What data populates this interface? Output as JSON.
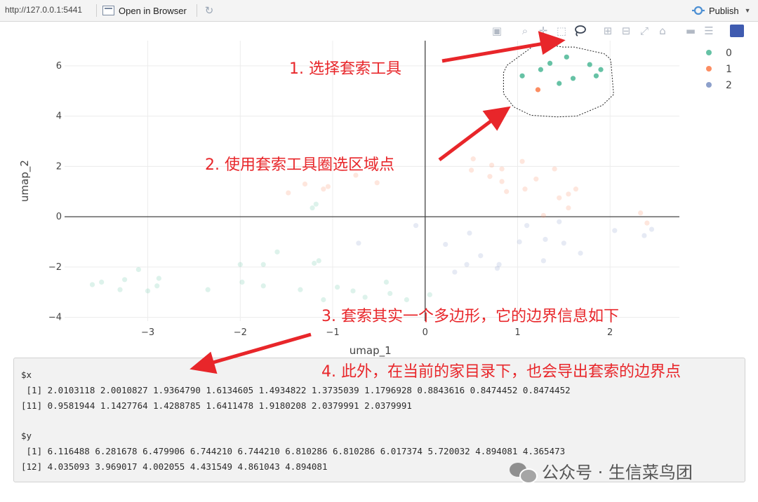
{
  "topbar": {
    "url": "http://127.0.0.1:5441",
    "open_browser_label": "Open in Browser",
    "publish_label": "Publish"
  },
  "modebar": {
    "icons": [
      "camera-icon",
      "zoom-icon",
      "pan-icon",
      "box-select-icon",
      "lasso-select-icon",
      "zoom-in-icon",
      "zoom-out-icon",
      "autoscale-icon",
      "reset-axes-icon",
      "hover-closest-icon",
      "hover-compare-icon",
      "plotly-logo-icon"
    ],
    "active": "lasso-select-icon"
  },
  "chart_data": {
    "type": "scatter",
    "xlabel": "umap_1",
    "ylabel": "umap_2",
    "xlim": [
      -3.9,
      2.75
    ],
    "ylim": [
      -4.15,
      7.0
    ],
    "xticks": [
      -3,
      -2,
      -1,
      0,
      1,
      2
    ],
    "yticks": [
      -4,
      -2,
      0,
      2,
      4,
      6
    ],
    "grid": true,
    "legend_position": "top-right",
    "colors": {
      "0": "#66c2a5",
      "1": "#fc8d62",
      "2": "#8da0cb"
    },
    "series": [
      {
        "name": "0",
        "selected": [
          [
            1.05,
            5.6
          ],
          [
            1.25,
            5.85
          ],
          [
            1.35,
            6.1
          ],
          [
            1.53,
            6.35
          ],
          [
            1.45,
            5.3
          ],
          [
            1.6,
            5.5
          ],
          [
            1.78,
            6.05
          ],
          [
            1.85,
            5.6
          ],
          [
            1.9,
            5.85
          ]
        ],
        "unselected": [
          [
            -3.6,
            -2.7
          ],
          [
            -3.5,
            -2.6
          ],
          [
            -3.3,
            -2.9
          ],
          [
            -3.25,
            -2.5
          ],
          [
            -3.1,
            -2.1
          ],
          [
            -3.0,
            -2.95
          ],
          [
            -2.88,
            -2.45
          ],
          [
            -2.9,
            -2.75
          ],
          [
            -2.35,
            -2.9
          ],
          [
            -2.0,
            -1.9
          ],
          [
            -1.98,
            -2.6
          ],
          [
            -1.75,
            -1.9
          ],
          [
            -1.75,
            -2.75
          ],
          [
            -1.6,
            -1.4
          ],
          [
            -1.35,
            -2.9
          ],
          [
            -1.22,
            0.35
          ],
          [
            -1.18,
            0.5
          ],
          [
            -1.2,
            -1.85
          ],
          [
            -1.15,
            -1.75
          ],
          [
            -1.1,
            -3.3
          ],
          [
            -0.95,
            -2.8
          ],
          [
            -0.78,
            -2.95
          ],
          [
            -0.65,
            -3.2
          ],
          [
            -0.42,
            -2.6
          ],
          [
            -0.38,
            -3.05
          ],
          [
            -0.2,
            -3.3
          ],
          [
            0.05,
            -3.1
          ]
        ]
      },
      {
        "name": "1",
        "selected": [
          [
            1.22,
            5.05
          ]
        ],
        "unselected": [
          [
            -1.48,
            0.95
          ],
          [
            -1.3,
            1.3
          ],
          [
            -1.1,
            1.1
          ],
          [
            -1.05,
            1.2
          ],
          [
            -0.75,
            1.65
          ],
          [
            -0.52,
            1.35
          ],
          [
            0.5,
            1.85
          ],
          [
            0.52,
            2.3
          ],
          [
            0.7,
            1.6
          ],
          [
            0.72,
            2.05
          ],
          [
            0.83,
            1.9
          ],
          [
            0.83,
            1.4
          ],
          [
            0.88,
            1.0
          ],
          [
            1.05,
            2.2
          ],
          [
            1.08,
            1.1
          ],
          [
            1.2,
            1.5
          ],
          [
            1.28,
            0.05
          ],
          [
            1.4,
            1.9
          ],
          [
            1.45,
            0.75
          ],
          [
            1.55,
            0.9
          ],
          [
            1.55,
            0.35
          ],
          [
            1.63,
            1.1
          ],
          [
            2.33,
            0.15
          ],
          [
            2.4,
            -0.25
          ]
        ]
      },
      {
        "name": "2",
        "selected": [],
        "unselected": [
          [
            -0.72,
            -1.05
          ],
          [
            -0.1,
            -0.35
          ],
          [
            0.22,
            -1.1
          ],
          [
            0.32,
            -2.2
          ],
          [
            0.45,
            -1.9
          ],
          [
            0.48,
            -0.65
          ],
          [
            0.6,
            -1.55
          ],
          [
            0.78,
            -2.05
          ],
          [
            0.8,
            -1.9
          ],
          [
            1.02,
            -1.0
          ],
          [
            1.1,
            -0.35
          ],
          [
            1.3,
            -0.9
          ],
          [
            1.28,
            -1.75
          ],
          [
            1.45,
            -0.2
          ],
          [
            1.5,
            -1.05
          ],
          [
            1.68,
            -1.45
          ],
          [
            2.05,
            -0.55
          ],
          [
            2.37,
            -0.75
          ],
          [
            2.45,
            -0.5
          ]
        ]
      }
    ],
    "lasso_polygon": {
      "x": [
        2.0103118,
        2.0010827,
        1.936479,
        1.6134605,
        1.4934822,
        1.3735039,
        1.1796928,
        0.8843616,
        0.8474452,
        0.8474452,
        0.9581944,
        1.1427764,
        1.4288785,
        1.6411478,
        1.9180208,
        2.0379991,
        2.0379991
      ],
      "y": [
        6.116488,
        6.281678,
        6.479906,
        6.74421,
        6.74421,
        6.810286,
        6.810286,
        6.017374,
        5.720032,
        4.894081,
        4.365473,
        4.035093,
        3.969017,
        4.002055,
        4.431549,
        4.861043,
        4.894081
      ]
    }
  },
  "console": {
    "lines": [
      "$x",
      " [1] 2.0103118 2.0010827 1.9364790 1.6134605 1.4934822 1.3735039 1.1796928 0.8843616 0.8474452 0.8474452",
      "[11] 0.9581944 1.1427764 1.4288785 1.6411478 1.9180208 2.0379991 2.0379991",
      "",
      "$y",
      " [1] 6.116488 6.281678 6.479906 6.744210 6.744210 6.810286 6.810286 6.017374 5.720032 4.894081 4.365473",
      "[12] 4.035093 3.969017 4.002055 4.431549 4.861043 4.894081"
    ]
  },
  "annotations": {
    "a1": "1. 选择套索工具",
    "a2": "2. 使用套索工具圈选区域点",
    "a3": "3. 套索其实一个多边形，它的边界信息如下",
    "a4": "4. 此外，在当前的家目录下，也会导出套索的边界点"
  },
  "watermark": "公众号 · 生信菜鸟团",
  "accent_color": "#e8262a"
}
